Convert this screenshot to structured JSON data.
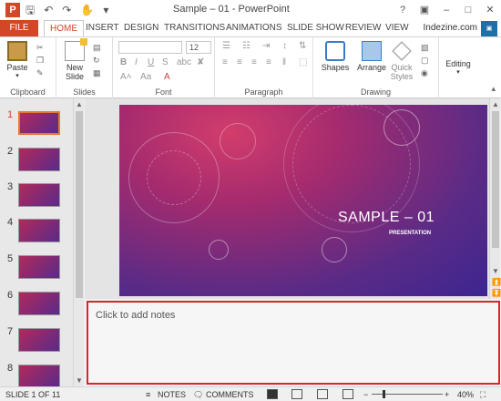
{
  "window": {
    "title": "Sample – 01 - PowerPoint",
    "app_icon": "powerpoint-icon",
    "quick_access": [
      "save-icon",
      "undo-icon",
      "redo-icon",
      "touch-mode-icon"
    ],
    "controls": [
      "help-icon",
      "restore-ribbon-icon",
      "minimize-icon",
      "maximize-icon",
      "close-icon"
    ]
  },
  "tabs": {
    "file": "FILE",
    "items": [
      "HOME",
      "INSERT",
      "DESIGN",
      "TRANSITIONS",
      "ANIMATIONS",
      "SLIDE SHOW",
      "REVIEW",
      "VIEW"
    ],
    "active": "HOME",
    "account": "Indezine.com"
  },
  "ribbon": {
    "clipboard": {
      "label": "Clipboard",
      "paste": "Paste"
    },
    "slides": {
      "label": "Slides",
      "new_slide_1": "New",
      "new_slide_2": "Slide"
    },
    "font": {
      "label": "Font",
      "size_value": "12"
    },
    "paragraph": {
      "label": "Paragraph"
    },
    "drawing": {
      "label": "Drawing",
      "shapes": "Shapes",
      "arrange": "Arrange",
      "quick_1": "Quick",
      "quick_2": "Styles"
    },
    "editing": {
      "label": "Editing"
    }
  },
  "thumbnails": [
    "1",
    "2",
    "3",
    "4",
    "5",
    "6",
    "7",
    "8"
  ],
  "selected_slide": 1,
  "slide": {
    "title": "SAMPLE – 01",
    "subtitle": "PRESENTATION"
  },
  "notes": {
    "placeholder": "Click to add notes"
  },
  "status": {
    "slide_info": "SLIDE 1 OF 11",
    "notes_btn": "NOTES",
    "comments_btn": "COMMENTS",
    "zoom": "40%"
  },
  "colors": {
    "accent": "#d24726",
    "notes_border": "#d8262b"
  }
}
